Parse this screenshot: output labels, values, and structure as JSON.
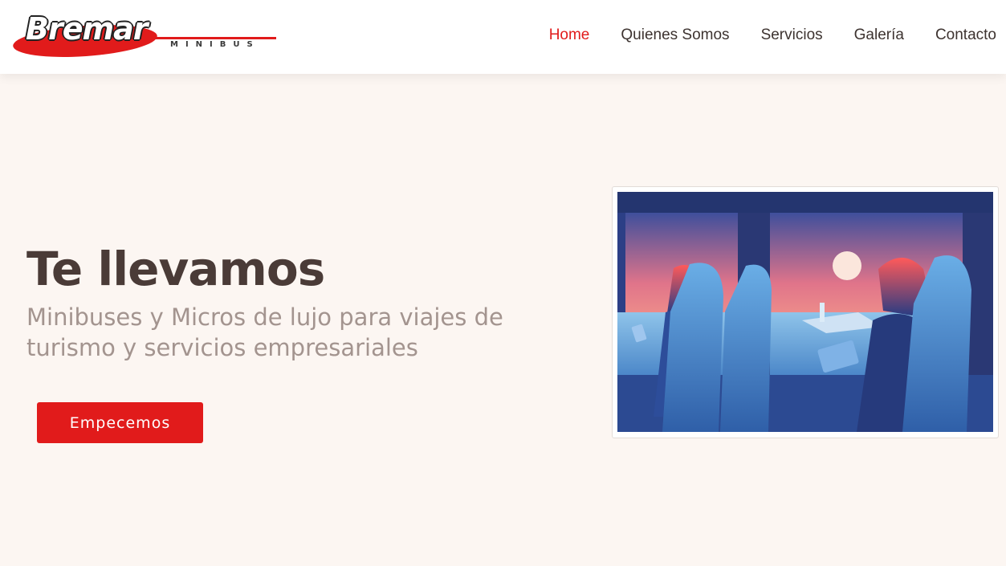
{
  "brand": {
    "name": "Bremar",
    "tagline": "MINIBUS",
    "accent_color": "#e11b1b"
  },
  "nav": {
    "items": [
      {
        "label": "Home",
        "active": true
      },
      {
        "label": "Quienes Somos",
        "active": false
      },
      {
        "label": "Servicios",
        "active": false
      },
      {
        "label": "Galería",
        "active": false
      },
      {
        "label": "Contacto",
        "active": false
      }
    ]
  },
  "hero": {
    "title": "Te llevamos",
    "subtitle": "Minibuses y Micros de lujo para viajes de turismo y servicios empresariales",
    "cta_label": "Empecemos",
    "illustration": "bus-interior-passengers-illustration"
  },
  "colors": {
    "background": "#fcf6f2",
    "title": "#4a3b37",
    "subtitle": "#a3948f",
    "nav_text": "#3d3330"
  }
}
